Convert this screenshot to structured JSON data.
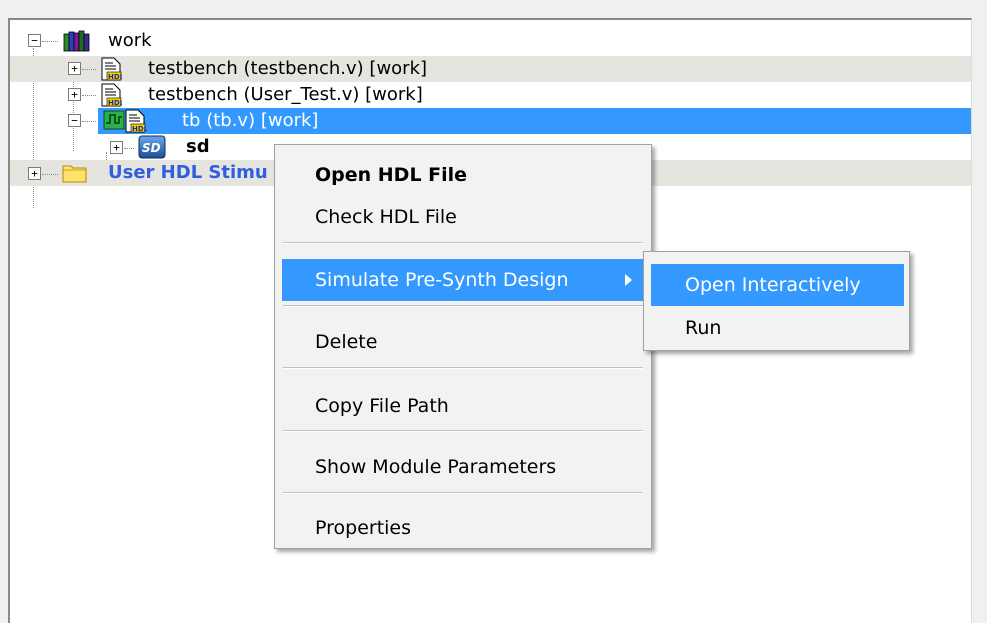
{
  "tree": {
    "root": {
      "label": "work",
      "toggle": "−",
      "icon": "library-books-icon"
    },
    "items": [
      {
        "label": "testbench (testbench.v) [work]",
        "toggle": "+",
        "icon": "hdl-file-icon"
      },
      {
        "label": "testbench (User_Test.v) [work]",
        "toggle": "+",
        "icon": "hdl-file-icon"
      },
      {
        "label": "tb (tb.v) [work]",
        "toggle": "−",
        "icon": "waveform-hdl-file-icon",
        "selected": true
      },
      {
        "label": "sd",
        "toggle": "+",
        "icon": "sd-module-icon",
        "badge": "SD"
      },
      {
        "label": "User HDL Stimu",
        "toggle": "+",
        "icon": "folder-icon"
      }
    ]
  },
  "context_menu": {
    "items": [
      {
        "label": "Open HDL File"
      },
      {
        "label": "Check HDL File"
      },
      {
        "label": "Simulate Pre-Synth Design"
      },
      {
        "label": "Delete"
      },
      {
        "label": "Copy File Path"
      },
      {
        "label": "Show Module Parameters"
      },
      {
        "label": "Properties"
      }
    ]
  },
  "submenu": {
    "items": [
      {
        "label": "Open Interactively"
      },
      {
        "label": "Run"
      }
    ]
  },
  "colors": {
    "selection": "#3399ff",
    "alt_row": "#e6e4df",
    "folder_label": "#2f5fe0"
  }
}
